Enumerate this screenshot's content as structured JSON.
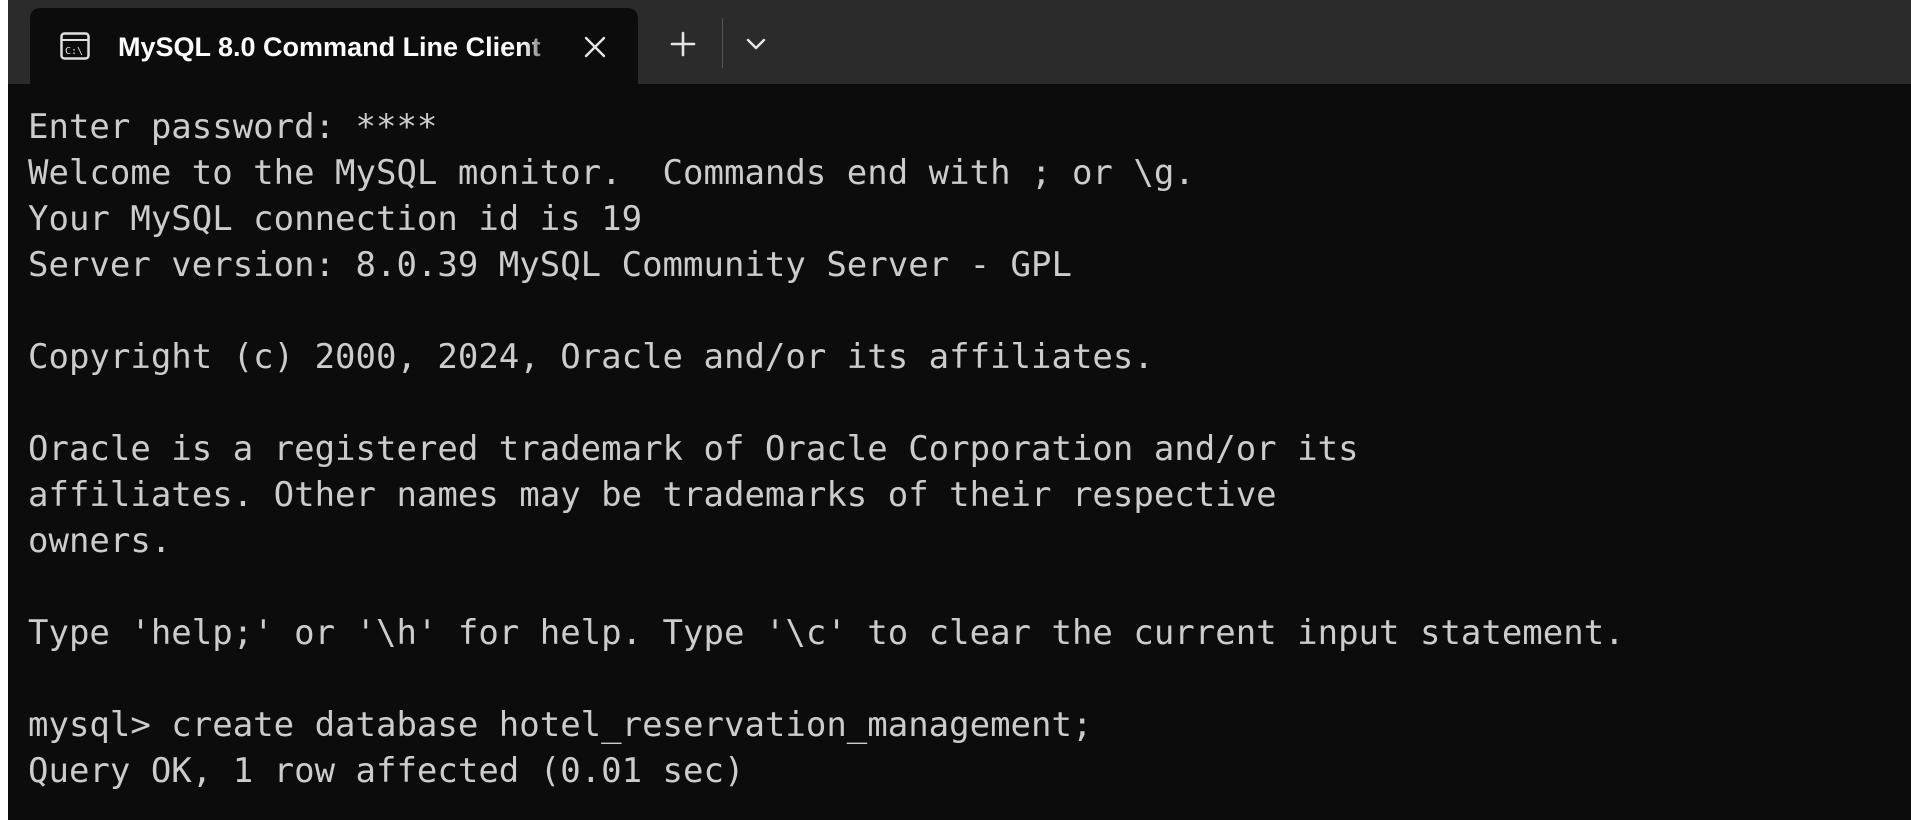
{
  "tab": {
    "title": "MySQL 8.0 Command Line Client",
    "icon": "console-icon"
  },
  "controls": {
    "close_icon": "close-icon",
    "new_tab_icon": "plus-icon",
    "dropdown_icon": "chevron-down-icon"
  },
  "terminal": {
    "lines": [
      "Enter password: ****",
      "Welcome to the MySQL monitor.  Commands end with ; or \\g.",
      "Your MySQL connection id is 19",
      "Server version: 8.0.39 MySQL Community Server - GPL",
      "",
      "Copyright (c) 2000, 2024, Oracle and/or its affiliates.",
      "",
      "Oracle is a registered trademark of Oracle Corporation and/or its",
      "affiliates. Other names may be trademarks of their respective",
      "owners.",
      "",
      "Type 'help;' or '\\h' for help. Type '\\c' to clear the current input statement.",
      "",
      "mysql> create database hotel_reservation_management;",
      "Query OK, 1 row affected (0.01 sec)"
    ]
  },
  "colors": {
    "terminal_bg": "#0c0c0c",
    "titlebar_bg": "#2b2b2b",
    "text": "#cccccc"
  }
}
